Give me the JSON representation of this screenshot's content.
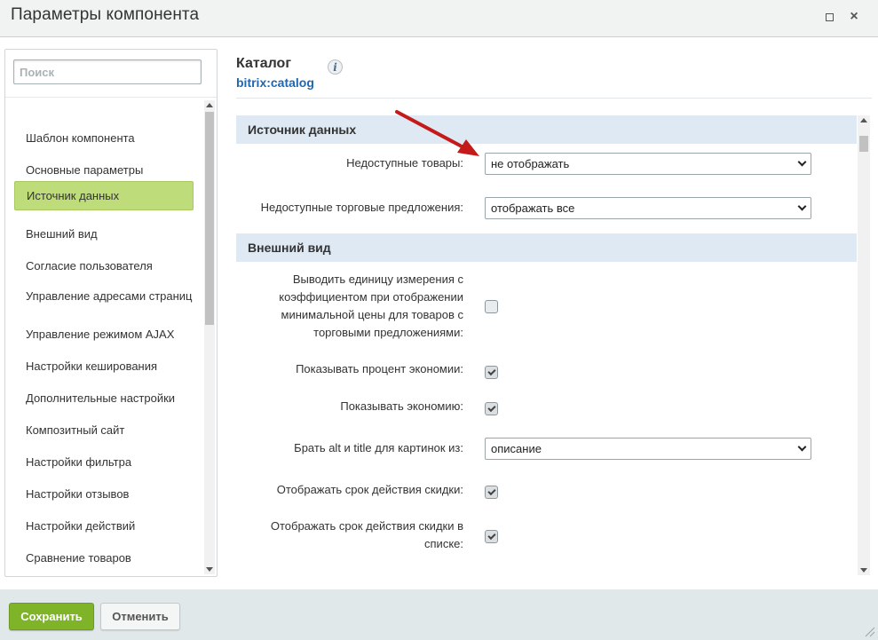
{
  "window": {
    "title": "Параметры компонента",
    "maximize_icon": "maximize-icon",
    "close_label": "×"
  },
  "search": {
    "placeholder": "Поиск",
    "value": ""
  },
  "sidebar": {
    "items": [
      {
        "label": "Шаблон компонента"
      },
      {
        "label": "Основные параметры"
      },
      {
        "label": "Источник данных",
        "active": true
      },
      {
        "label": "Внешний вид"
      },
      {
        "label": "Согласие пользователя"
      },
      {
        "label": "Управление адресами страниц"
      },
      {
        "label": "Управление режимом AJAX"
      },
      {
        "label": "Настройки кеширования"
      },
      {
        "label": "Дополнительные настройки"
      },
      {
        "label": "Композитный сайт"
      },
      {
        "label": "Настройки фильтра"
      },
      {
        "label": "Настройки отзывов"
      },
      {
        "label": "Настройки действий"
      },
      {
        "label": "Сравнение товаров"
      }
    ]
  },
  "component": {
    "name": "Каталог",
    "code": "bitrix:catalog",
    "info_icon": "i"
  },
  "sections": {
    "data_source": {
      "title": "Источник данных",
      "unavailable_goods": {
        "label": "Недоступные товары:",
        "value": "не отображать"
      },
      "unavailable_offers": {
        "label": "Недоступные торговые предложения:",
        "value": "отображать все"
      }
    },
    "appearance": {
      "title": "Внешний вид",
      "unit_ratio": {
        "label": "Выводить единицу измерения с коэффициентом при отображении минимальной цены для товаров с торговыми предложениями:",
        "checked": false
      },
      "show_discount_percent": {
        "label": "Показывать процент экономии:",
        "checked": true
      },
      "show_economy": {
        "label": "Показывать экономию:",
        "checked": true
      },
      "alt_title_source": {
        "label": "Брать alt и title для картинок из:",
        "value": "описание"
      },
      "show_discount_period": {
        "label": "Отображать срок действия скидки:",
        "checked": true
      },
      "show_discount_period_list": {
        "label": "Отображать срок действия скидки в списке:",
        "checked": true
      }
    }
  },
  "footer": {
    "save_label": "Сохранить",
    "cancel_label": "Отменить"
  },
  "colors": {
    "active_nav": "#bfdc7a",
    "section_header": "#dfe9f3",
    "save_button": "#7fb429",
    "link": "#2067b0",
    "annotation_arrow": "#c41a1a"
  }
}
